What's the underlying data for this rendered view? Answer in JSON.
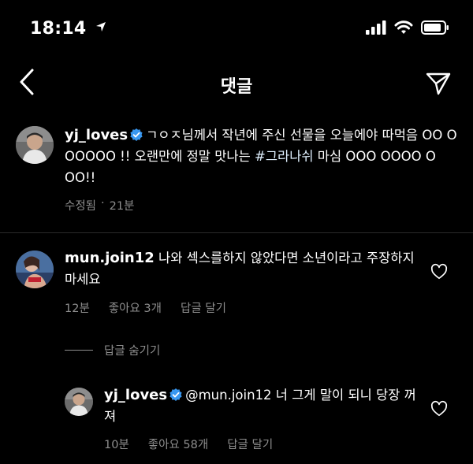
{
  "status_bar": {
    "time": "18:14"
  },
  "nav": {
    "title": "댓글"
  },
  "caption": {
    "username": "yj_loves",
    "text": "ㄱㅇㅈ님께서 작년에 주신 선물을 오늘에야 따먹음 OO O OOOOO !! 오랜만에 정말 맛나는 ",
    "hashtag": "#그라나쉬",
    "text_after": " 마심 OOO OOOO O OO!!",
    "edited": "수정됨",
    "separator": "·",
    "time": "21분"
  },
  "comments": [
    {
      "username": "mun.join12",
      "text": "나와 섹스를하지 않았다면 소년이라고 주장하지 마세요",
      "time": "12분",
      "likes": "좋아요 3개",
      "reply_label": "답글 달기",
      "hide_replies_label": "답글 숨기기",
      "replies": [
        {
          "username": "yj_loves",
          "text": "@mun.join12 너 그게 말이 되니 당장 꺼져",
          "time": "10분",
          "likes": "좋아요 58개",
          "reply_label": "답글 달기"
        }
      ]
    }
  ],
  "icons": {
    "verified_color": "#3897f0",
    "status": [
      "signal-icon",
      "wifi-icon",
      "battery-icon"
    ],
    "nav": [
      "back-arrow-icon",
      "send-icon"
    ],
    "comment": [
      "heart-icon",
      "verified-badge-icon"
    ]
  }
}
